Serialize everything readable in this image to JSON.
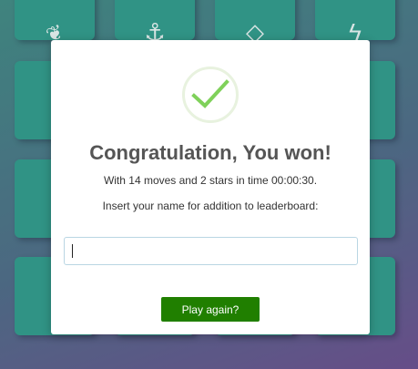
{
  "board": {
    "cards": [
      {
        "icon": "leaf-icon",
        "glyph": "❦"
      },
      {
        "icon": "anchor-icon",
        "glyph": "⚓"
      },
      {
        "icon": "diamond-icon",
        "glyph": "◇"
      },
      {
        "icon": "bolt-icon",
        "glyph": "ϟ"
      },
      {
        "icon": "anchor-icon",
        "glyph": "⚓"
      },
      {
        "icon": "",
        "glyph": ""
      },
      {
        "icon": "",
        "glyph": ""
      },
      {
        "icon": "",
        "glyph": ""
      },
      {
        "icon": "leaf-icon",
        "glyph": "❦"
      },
      {
        "icon": "",
        "glyph": ""
      },
      {
        "icon": "",
        "glyph": ""
      },
      {
        "icon": "",
        "glyph": ""
      },
      {
        "icon": "paper-plane-icon",
        "glyph": "➤"
      },
      {
        "icon": "",
        "glyph": ""
      },
      {
        "icon": "",
        "glyph": ""
      },
      {
        "icon": "",
        "glyph": ""
      }
    ]
  },
  "modal": {
    "title": "Congratulation, You won!",
    "stats": "With 14 moves and 2 stars in time 00:00:30.",
    "prompt": "Insert your name for addition to leaderboard:",
    "name_value": "",
    "button_label": "Play again?"
  },
  "colors": {
    "card": "#2f9b8a",
    "button": "#207f00",
    "check": "#7fd15a"
  }
}
